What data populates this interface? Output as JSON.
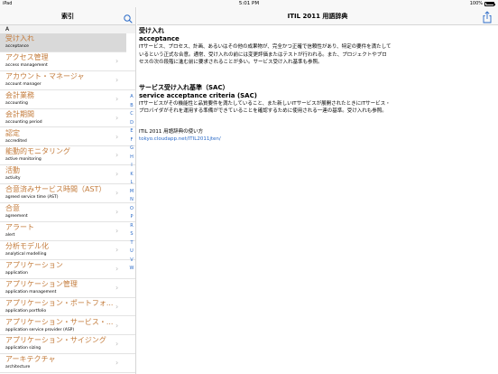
{
  "status": {
    "left": "iPad",
    "time": "5:01 PM",
    "battery": "100%"
  },
  "sidebar": {
    "title": "索引",
    "section": "A",
    "items": [
      {
        "title": "受け入れ",
        "sub": "acceptance"
      },
      {
        "title": "アクセス管理",
        "sub": "access management"
      },
      {
        "title": "アカウント・マネージャ",
        "sub": "account manager"
      },
      {
        "title": "会計業務",
        "sub": "accounting"
      },
      {
        "title": "会計期間",
        "sub": "accounting period"
      },
      {
        "title": "認定",
        "sub": "accredited"
      },
      {
        "title": "能動的モニタリング",
        "sub": "active monitoring"
      },
      {
        "title": "活動",
        "sub": "activity"
      },
      {
        "title": "合意済みサービス時間（AST）",
        "sub": "agreed service time (AST)"
      },
      {
        "title": "合意",
        "sub": "agreement"
      },
      {
        "title": "アラート",
        "sub": "alert"
      },
      {
        "title": "分析モデル化",
        "sub": "analytical modelling"
      },
      {
        "title": "アプリケーション",
        "sub": "application"
      },
      {
        "title": "アプリケーション管理",
        "sub": "application management"
      },
      {
        "title": "アプリケーション・ポートフォ...",
        "sub": "application portfolio"
      },
      {
        "title": "アプリケーション・サービス・...",
        "sub": "application service provider (ASP)"
      },
      {
        "title": "アプリケーション・サイジング",
        "sub": "application sizing"
      },
      {
        "title": "アーキテクチャ",
        "sub": "architecture"
      }
    ],
    "index": [
      "A",
      "B",
      "C",
      "D",
      "E",
      "F",
      "G",
      "H",
      "I",
      "K",
      "L",
      "M",
      "N",
      "O",
      "P",
      "R",
      "S",
      "T",
      "U",
      "V",
      "W"
    ]
  },
  "detail": {
    "header_title": "ITIL 2011 用語辞典",
    "term1_ja": "受け入れ",
    "term1_en": "acceptance",
    "term1_desc": "ITサービス、プロセス、計画、あるいはその他の成果物が、完全かつ正確で信頼性があり、特定の要件を満たしているという正式な合意。通常、受け入れの前には変更評価またはテストが行われる。また、プロジェクトやプロセスの次の段階に進む前に要求されることが多い。サービス受け入れ基準も参照。",
    "term2_ja": "サービス受け入れ基準（SAC）",
    "term2_en": "service acceptance criteria (SAC)",
    "term2_desc": "ITサービスがその機能性と品質要件を満たしていること、また新しいITサービスが展開されたときにITサービス・プロバイダがそれを運用する準備ができていることを確認するために使用される一連の基準。受け入れも参照。",
    "usage_label": "ITIL 2011 用語辞典の使い方",
    "usage_link": "tokyo.cloudapp.net/ITIL2011jten/"
  }
}
